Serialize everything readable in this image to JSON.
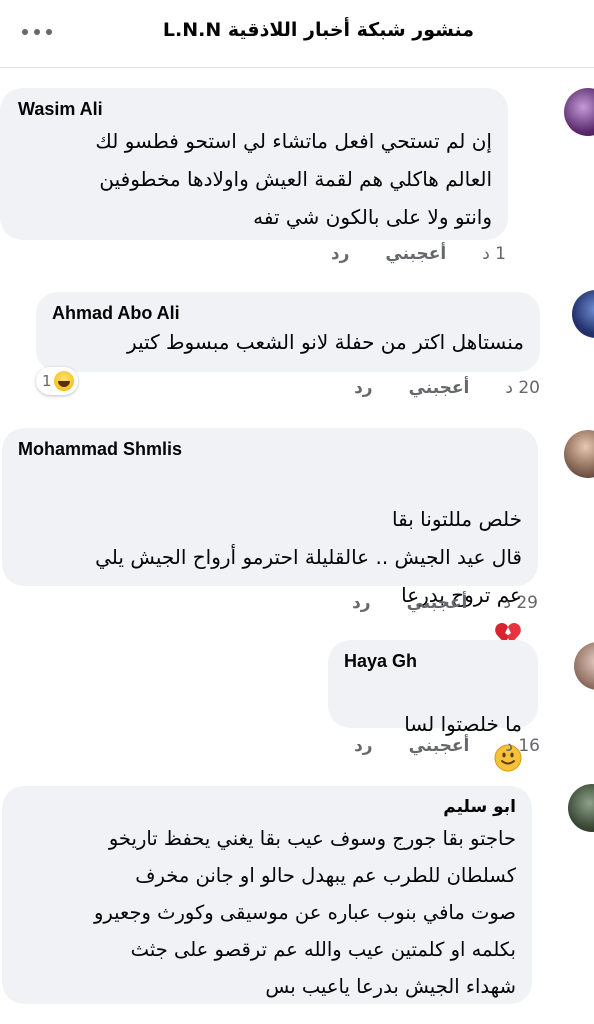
{
  "header": {
    "title": "منشور شبكة أخبار اللاذقية L.N.N",
    "more_icon": "more-horizontal-icon"
  },
  "actions": {
    "like": "أعجبني",
    "reply": "رد"
  },
  "comments": [
    {
      "author": "Wasim Ali",
      "text": "إن لم تستحي افعل ماتشاء لي استحو فطسو لك\nالعالم هاكلي هم لقمة العيش واولادها مخطوفين\nوانتو ولا على بالكون شي تفه",
      "time": "1 د"
    },
    {
      "author": "Ahmad Abo Ali",
      "text": "منستاهل اكتر من حفلة لانو الشعب مبسوط كتير",
      "time": "20 د",
      "reaction": {
        "icon": "laughing-emoji-icon",
        "count": "1"
      }
    },
    {
      "author": "Mohammad Shmlis",
      "text": "خلص مللتونا بقا\nقال عيد الجيش .. عالقليلة احترمو أرواح الجيش يلي\nعم تروح بدرعا",
      "emoji": "broken-heart-icon",
      "time": "29 د"
    },
    {
      "author": "Haya Gh",
      "text": "ما خلصتوا لسا",
      "emoji": "slightly-smiling-face-icon",
      "time": "16 د"
    },
    {
      "author": "ابو سليم",
      "text": "حاجتو بقا جورج وسوف عيب بقا يغني يحفظ تاريخو\nكسلطان للطرب عم يبهدل حالو او جانن مخرف\nصوت مافي بنوب عباره عن موسيقى وكورث وجعيرو\nبكلمه او كلمتين عيب والله عم ترقصو على جثث\nشهداء الجيش بدرعا ياعيب بس"
    }
  ]
}
